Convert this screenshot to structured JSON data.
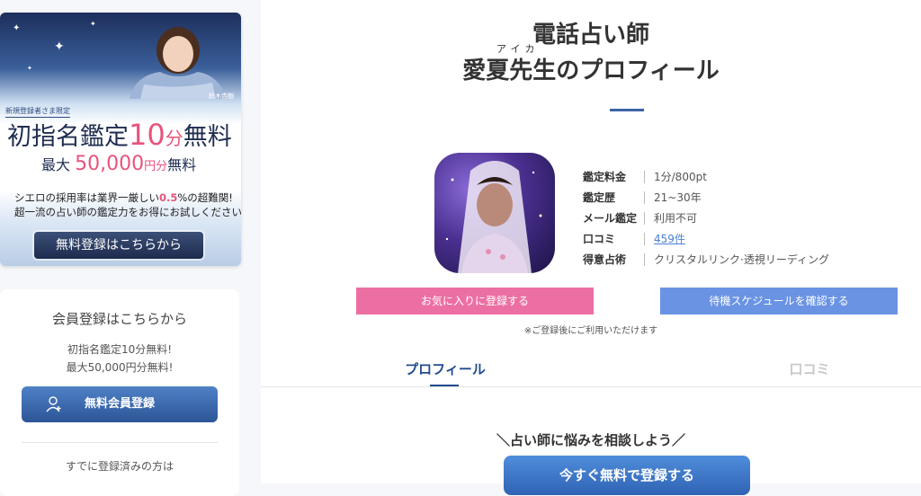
{
  "banner": {
    "person_name": "鈴木杏樹",
    "tag": "新規登録者さま限定",
    "title_prefix": "初指名鑑定",
    "title_number": "10",
    "title_unit": "分",
    "title_suffix": "無料",
    "sub_prefix": "最大",
    "sub_amount": "50,000",
    "sub_unit": "円分",
    "sub_suffix": "無料",
    "line1_prefix": "シエロの採用率は業界一厳しい",
    "line1_highlight": "0.5",
    "line1_suffix": "%の超難関!",
    "line2": "超一流の占い師の鑑定力をお得にお試しください。",
    "button": "無料登録はこちらから"
  },
  "member": {
    "title": "会員登録はこちらから",
    "desc1": "初指名鑑定10分無料!",
    "desc2": "最大50,000円分無料!",
    "button": "無料会員登録",
    "button_icon": "user-add-icon",
    "already": "すでに登録済みの方は"
  },
  "profile": {
    "subtitle": "電話占い師",
    "ruby": "アイカ",
    "title": "愛夏先生のプロフィール",
    "info": [
      {
        "label": "鑑定料金",
        "value": "1分/800pt"
      },
      {
        "label": "鑑定歴",
        "value": "21~30年"
      },
      {
        "label": "メール鑑定",
        "value": "利用不可"
      },
      {
        "label": "口コミ",
        "value": "459件"
      },
      {
        "label": "得意占術",
        "value": "クリスタルリンク·透視リーディング"
      }
    ],
    "favorite_button": "お気に入りに登録する",
    "schedule_button": "待機スケジュールを確認する",
    "note": "※ご登録後にご利用いただけます"
  },
  "tabs": {
    "profile": "プロフィール",
    "reviews": "口コミ"
  },
  "consult": {
    "heading": "＼占い師に悩みを相談しよう／",
    "button": "今すぐ無料で登録する"
  },
  "colors": {
    "accent_blue": "#234b8f",
    "pink": "#ec6fa3",
    "light_blue": "#6a93e3",
    "link": "#4a82d6"
  }
}
